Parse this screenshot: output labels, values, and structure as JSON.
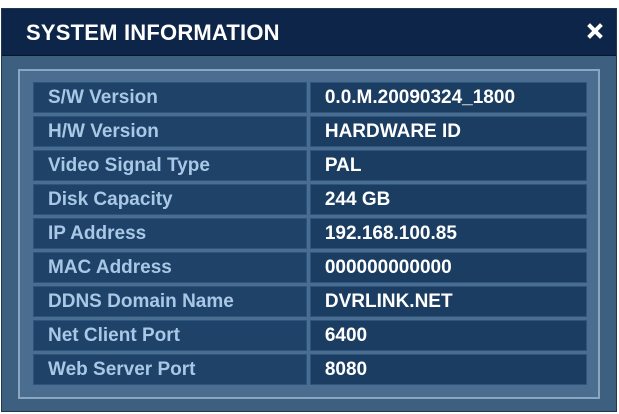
{
  "dialog": {
    "title": "SYSTEM INFORMATION",
    "close_icon": "close-icon"
  },
  "rows": [
    {
      "label": "S/W Version",
      "value": "0.0.M.20090324_1800"
    },
    {
      "label": "H/W Version",
      "value": "HARDWARE ID"
    },
    {
      "label": "Video Signal Type",
      "value": "PAL"
    },
    {
      "label": "Disk Capacity",
      "value": "244 GB"
    },
    {
      "label": "IP Address",
      "value": "192.168.100.85"
    },
    {
      "label": "MAC Address",
      "value": "000000000000"
    },
    {
      "label": "DDNS Domain Name",
      "value": "DVRLINK.NET"
    },
    {
      "label": "Net Client Port",
      "value": "6400"
    },
    {
      "label": "Web Server Port",
      "value": "8080"
    }
  ],
  "colors": {
    "titlebar": "#0d2548",
    "body": "#3d5f80",
    "label_text": "#a9c8e6",
    "value_text": "#ffffff"
  }
}
